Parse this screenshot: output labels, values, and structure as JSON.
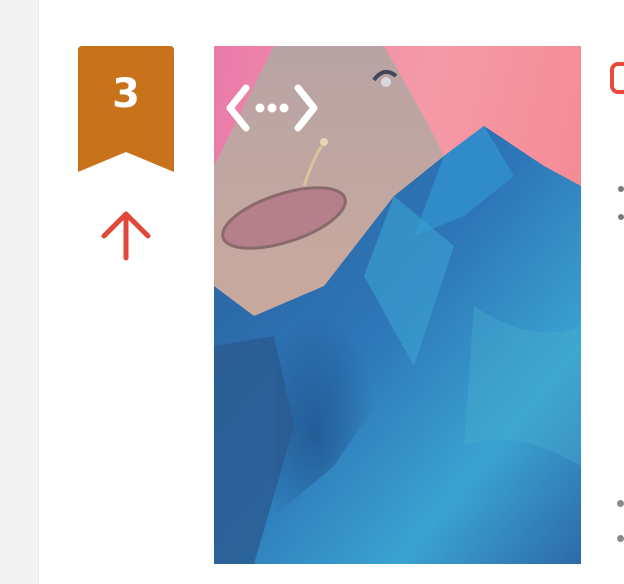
{
  "rank": {
    "number": "3",
    "badge_color": "#c8731c",
    "trend": "up",
    "trend_icon": "arrow-up-icon",
    "trend_color": "#e2483a"
  },
  "thumbnail": {
    "overlay_icon": "embed-code-icon",
    "background_colors": [
      "#f2889a",
      "#2f6da8",
      "#3ca6cf"
    ]
  },
  "colors": {
    "page_background": "#ffffff",
    "left_rail": "#f3f3f3",
    "title_accent": "#e84a3b"
  }
}
